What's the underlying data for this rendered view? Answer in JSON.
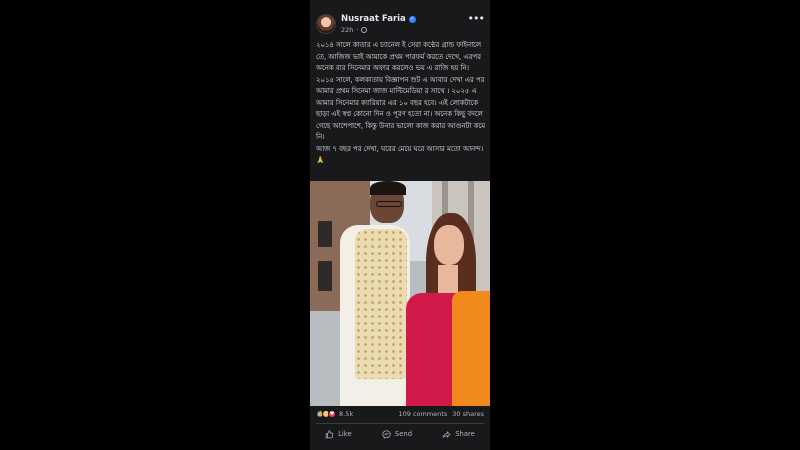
{
  "post": {
    "author": "Nusraat Faria",
    "time": "22h",
    "more_icon": "more-horizontal-icon",
    "verified_icon": "verified-badge-icon",
    "privacy_icon": "globe-icon",
    "paragraphs": [
      "২০১৪ সালে কাতার এ চ্যানেল ই সেরা কণ্ঠের গ্রান্ড ফাইনালে তে, আজিজ ভাই আমাকে প্রথম পারফর্ম করতে দেখে, এরপর অনেক বার সিনেমার অফার করলেও ভয় এ রাজি হয় নি। ২০১৫ সালে, কলকাতায় বিজ্ঞাপন শুট এ আবার দেখা এর পর আমার প্রথম সিনেমা জাজ মাল্টিমেডিয়া র সাথে । ২০২৫ এ আমার সিনেমার ক্যারিয়ার এর ১০ বছর হবে। এই লোকটাকে ছাড়া এই স্বপ্ন কোনো দিন ও পূরণ হতো না। অনেক কিছু বদলে গেছে আশেপাশে, কিন্তু উনার ভালো কাজ করার আগুনটা কমে নি।",
      "আজ ৭ বছর পর দেখা, ঘরের মেয়ে ঘরে আসার মতো আনন্দ। 🙏"
    ]
  },
  "stats": {
    "reaction_count": "8.5k",
    "comments": "109 comments",
    "shares": "30 shares",
    "reaction_icons": [
      "like-reaction-icon",
      "haha-reaction-icon",
      "love-reaction-icon"
    ]
  },
  "actions": {
    "like": "Like",
    "send": "Send",
    "share": "Share"
  },
  "colors": {
    "background": "#18191a",
    "text": "#e4e6eb",
    "muted": "#b0b3b8",
    "accent": "#2d88ff"
  }
}
